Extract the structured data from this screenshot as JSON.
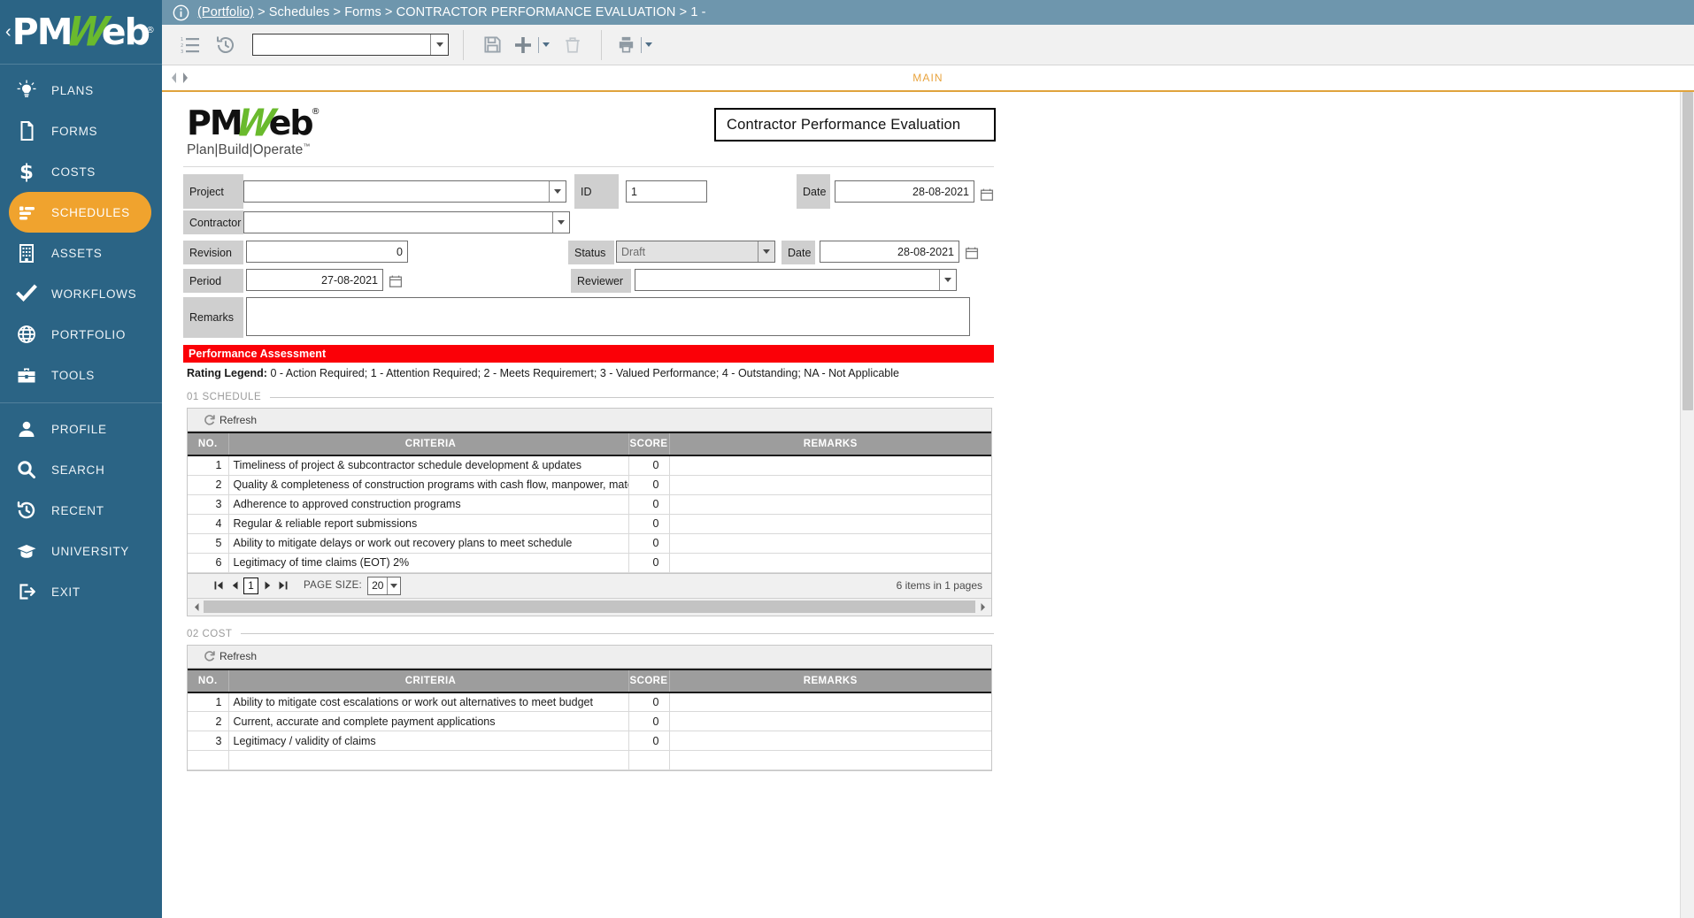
{
  "sidebar": {
    "logo": {
      "prefix": "PM",
      "w": "W",
      "suffix": "eb",
      "reg": "®"
    },
    "items": [
      {
        "label": "PLANS",
        "icon": "bulb-icon",
        "active": false
      },
      {
        "label": "FORMS",
        "icon": "document-icon",
        "active": false
      },
      {
        "label": "COSTS",
        "icon": "dollar-icon",
        "active": false
      },
      {
        "label": "SCHEDULES",
        "icon": "bars-icon",
        "active": true
      },
      {
        "label": "ASSETS",
        "icon": "building-icon",
        "active": false
      },
      {
        "label": "WORKFLOWS",
        "icon": "check-icon",
        "active": false
      },
      {
        "label": "PORTFOLIO",
        "icon": "globe-icon",
        "active": false
      },
      {
        "label": "TOOLS",
        "icon": "toolbox-icon",
        "active": false
      }
    ],
    "items2": [
      {
        "label": "PROFILE",
        "icon": "user-icon"
      },
      {
        "label": "SEARCH",
        "icon": "search-icon"
      },
      {
        "label": "RECENT",
        "icon": "history-icon"
      },
      {
        "label": "UNIVERSITY",
        "icon": "graduation-icon"
      },
      {
        "label": "EXIT",
        "icon": "exit-icon"
      }
    ]
  },
  "breadcrumb": {
    "root": "(Portfolio)",
    "full": "(Portfolio) > Schedules > Forms > CONTRACTOR PERFORMANCE EVALUATION > 1 -",
    "rest": " > Schedules > Forms > CONTRACTOR PERFORMANCE EVALUATION > 1 -"
  },
  "toolbar": {
    "list_icon": "numbered-list-icon",
    "history_icon": "history-icon",
    "select_value": "",
    "save_icon": "save-icon",
    "add_icon": "add-icon",
    "delete_icon": "trash-icon",
    "print_icon": "print-icon"
  },
  "tabs": {
    "main": "MAIN"
  },
  "doc": {
    "logo": {
      "prefix": "PM",
      "w": "W",
      "suffix": "eb",
      "reg": "®",
      "tagline": "Plan|Build|Operate",
      "tm": "™"
    },
    "title": "Contractor Performance Evaluation"
  },
  "form": {
    "project_label": "Project",
    "project_value": "",
    "contractor_label": "Contractor",
    "contractor_value": "",
    "revision_label": "Revision",
    "revision_value": "0",
    "period_label": "Period",
    "period_value": "27-08-2021",
    "remarks_label": "Remarks",
    "remarks_value": "",
    "id_label": "ID",
    "id_value": "1",
    "date1_label": "Date",
    "date1_value": "28-08-2021",
    "status_label": "Status",
    "status_value": "Draft",
    "date2_label": "Date",
    "date2_value": "28-08-2021",
    "reviewer_label": "Reviewer",
    "reviewer_value": ""
  },
  "assessment": {
    "banner": "Performance Assessment",
    "banner_color": "#fb0007",
    "legend_label": "Rating Legend:",
    "legend_text": " 0 - Action Required; 1 - Attention Required; 2 - Meets Requiremert; 3 - Valued Performance; 4 - Outstanding; NA - Not Applicable"
  },
  "grid_columns": {
    "no": "NO.",
    "criteria": "CRITERIA",
    "score": "SCORE",
    "remarks": "REMARKS"
  },
  "refresh_label": "Refresh",
  "sections": [
    {
      "title": "01 SCHEDULE",
      "rows": [
        {
          "no": "1",
          "criteria": "Timeliness of project & subcontractor schedule development & updates",
          "score": "0",
          "remarks": ""
        },
        {
          "no": "2",
          "criteria": "Quality & completeness of construction programs with cash flow, manpower, mater",
          "score": "0",
          "remarks": ""
        },
        {
          "no": "3",
          "criteria": "Adherence to approved construction programs",
          "score": "0",
          "remarks": ""
        },
        {
          "no": "4",
          "criteria": "Regular & reliable report submissions",
          "score": "0",
          "remarks": ""
        },
        {
          "no": "5",
          "criteria": "Ability to mitigate delays or work out recovery plans to meet schedule",
          "score": "0",
          "remarks": ""
        },
        {
          "no": "6",
          "criteria": "Legitimacy of time claims (EOT) 2%",
          "score": "0",
          "remarks": ""
        }
      ],
      "pager": {
        "page": "1",
        "page_size_label": "PAGE SIZE:",
        "page_size": "20",
        "info": "6 items in 1 pages"
      }
    },
    {
      "title": "02 COST",
      "rows": [
        {
          "no": "1",
          "criteria": "Ability to mitigate cost escalations or work out alternatives to meet budget",
          "score": "0",
          "remarks": ""
        },
        {
          "no": "2",
          "criteria": "Current, accurate and complete payment applications",
          "score": "0",
          "remarks": ""
        },
        {
          "no": "3",
          "criteria": "Legitimacy / validity of claims",
          "score": "0",
          "remarks": ""
        }
      ],
      "pager": null
    }
  ]
}
